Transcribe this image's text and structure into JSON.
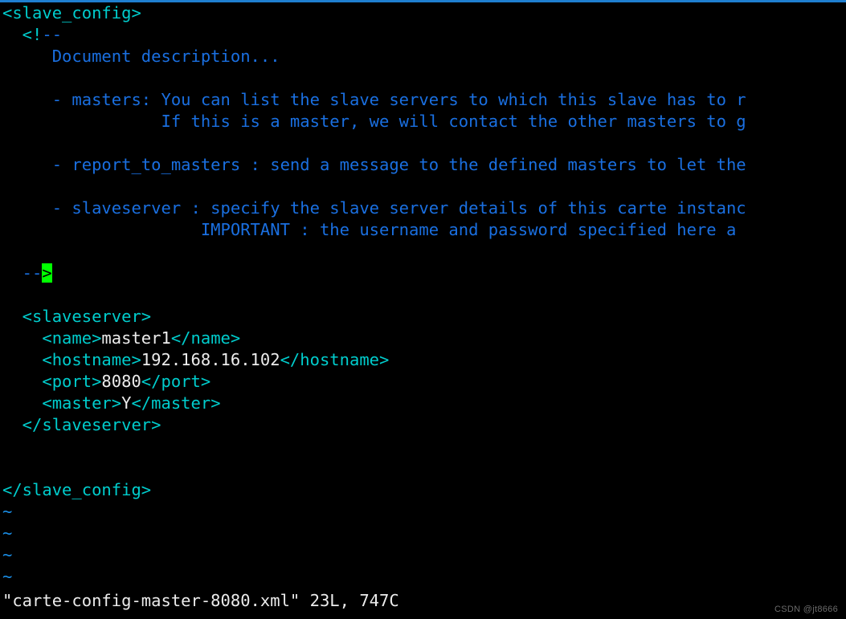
{
  "app": {
    "name": "vim",
    "filename": "carte-config-master-8080.xml"
  },
  "colors": {
    "background": "#000000",
    "tag": "#00cdcd",
    "comment": "#1a6fe0",
    "value": "#ececec",
    "tilde": "#1a8fe8",
    "cursor": "#00ff00",
    "top_rule": "#1f7fd0"
  },
  "editor": {
    "lines": [
      {
        "n": 1,
        "segments": [
          {
            "cls": "tag",
            "t": "<slave_config>"
          }
        ]
      },
      {
        "n": 2,
        "segments": [
          {
            "cls": "tag",
            "t": "  <!"
          },
          {
            "cls": "comment",
            "t": "--"
          }
        ]
      },
      {
        "n": 3,
        "segments": [
          {
            "cls": "comment",
            "t": "     Document description..."
          }
        ]
      },
      {
        "n": 4,
        "segments": [
          {
            "cls": "comment",
            "t": ""
          }
        ]
      },
      {
        "n": 5,
        "segments": [
          {
            "cls": "comment",
            "t": "     - masters: You can list the slave servers to which this slave has to r"
          }
        ]
      },
      {
        "n": 6,
        "segments": [
          {
            "cls": "comment",
            "t": "                If this is a master, we will contact the other masters to g"
          }
        ]
      },
      {
        "n": 7,
        "segments": [
          {
            "cls": "comment",
            "t": ""
          }
        ]
      },
      {
        "n": 8,
        "segments": [
          {
            "cls": "comment",
            "t": "     - report_to_masters : send a message to the defined masters to let the"
          }
        ]
      },
      {
        "n": 9,
        "segments": [
          {
            "cls": "comment",
            "t": ""
          }
        ]
      },
      {
        "n": 10,
        "segments": [
          {
            "cls": "comment",
            "t": "     - slaveserver : specify the slave server details of this carte instanc"
          }
        ]
      },
      {
        "n": 11,
        "segments": [
          {
            "cls": "comment",
            "t": "                    IMPORTANT : the username and password specified here a"
          }
        ]
      },
      {
        "n": 12,
        "segments": [
          {
            "cls": "comment",
            "t": ""
          }
        ]
      },
      {
        "n": 13,
        "segments": [
          {
            "cls": "comment",
            "t": "  --"
          },
          {
            "cls": "cursor",
            "t": ">"
          }
        ]
      },
      {
        "n": 14,
        "segments": [
          {
            "cls": "plain",
            "t": ""
          }
        ]
      },
      {
        "n": 15,
        "segments": [
          {
            "cls": "tag",
            "t": "  <slaveserver>"
          }
        ]
      },
      {
        "n": 16,
        "segments": [
          {
            "cls": "tag",
            "t": "    <name>"
          },
          {
            "cls": "val",
            "t": "master1"
          },
          {
            "cls": "tag",
            "t": "</name>"
          }
        ]
      },
      {
        "n": 17,
        "segments": [
          {
            "cls": "tag",
            "t": "    <hostname>"
          },
          {
            "cls": "val",
            "t": "192.168.16.102"
          },
          {
            "cls": "tag",
            "t": "</hostname>"
          }
        ]
      },
      {
        "n": 18,
        "segments": [
          {
            "cls": "tag",
            "t": "    <port>"
          },
          {
            "cls": "val",
            "t": "8080"
          },
          {
            "cls": "tag",
            "t": "</port>"
          }
        ]
      },
      {
        "n": 19,
        "segments": [
          {
            "cls": "tag",
            "t": "    <master>"
          },
          {
            "cls": "val",
            "t": "Y"
          },
          {
            "cls": "tag",
            "t": "</master>"
          }
        ]
      },
      {
        "n": 20,
        "segments": [
          {
            "cls": "tag",
            "t": "  </slaveserver>"
          }
        ]
      },
      {
        "n": 21,
        "segments": [
          {
            "cls": "plain",
            "t": ""
          }
        ]
      },
      {
        "n": 22,
        "segments": [
          {
            "cls": "plain",
            "t": ""
          }
        ]
      },
      {
        "n": 23,
        "segments": [
          {
            "cls": "tag",
            "t": "</slave_config>"
          }
        ]
      },
      {
        "n": 24,
        "segments": [
          {
            "cls": "tilde",
            "t": "~"
          }
        ]
      },
      {
        "n": 25,
        "segments": [
          {
            "cls": "tilde",
            "t": "~"
          }
        ]
      },
      {
        "n": 26,
        "segments": [
          {
            "cls": "tilde",
            "t": "~"
          }
        ]
      },
      {
        "n": 27,
        "segments": [
          {
            "cls": "tilde",
            "t": "~"
          }
        ]
      }
    ]
  },
  "statusline": {
    "text": "\"carte-config-master-8080.xml\" 23L, 747C",
    "file_quoted": "\"carte-config-master-8080.xml\"",
    "line_count": "23L",
    "char_count": "747C"
  },
  "watermark": {
    "text": "CSDN @jt8666"
  }
}
